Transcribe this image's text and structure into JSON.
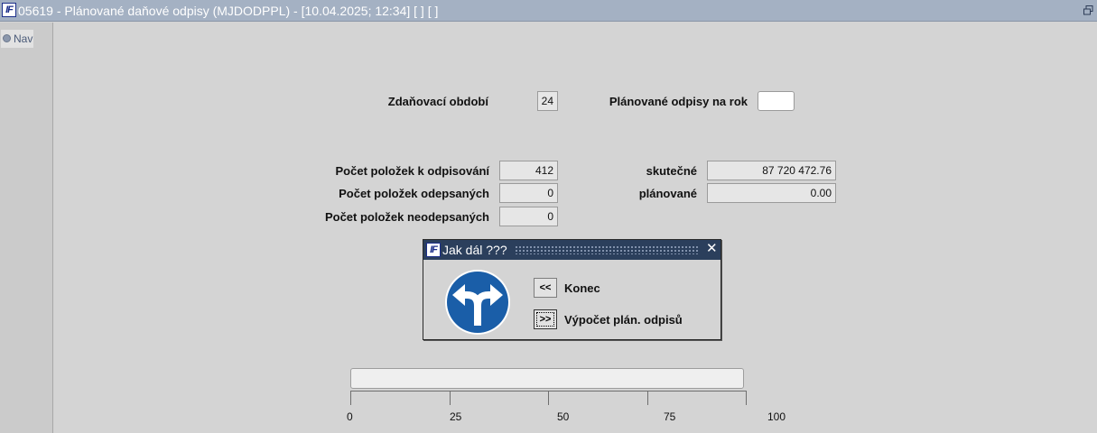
{
  "window": {
    "title": "05619 - Plánované daňové odpisy (MJDODPPL) - [10.04.2025; 12:34]  [ ]  [ ]",
    "logo_text": "IF"
  },
  "nav": {
    "label": "Nav"
  },
  "form": {
    "period_label": "Zdaňovací období",
    "period_value": "24",
    "planned_year_label": "Plánované odpisy na rok",
    "planned_year_value": "",
    "count_to_depreciate_label": "Počet položek k odpisování",
    "count_to_depreciate_value": "412",
    "count_depreciated_label": "Počet položek odepsaných",
    "count_depreciated_value": "0",
    "count_not_depreciated_label": "Počet položek neodepsaných",
    "count_not_depreciated_value": "0",
    "actual_label": "skutečné",
    "actual_value": "87 720 472.76",
    "planned_label": "plánované",
    "planned_value": "0.00"
  },
  "dialog": {
    "title": "Jak dál ???",
    "close_glyph": "✕",
    "back_button": "<<",
    "back_label": "Konec",
    "next_button": ">>",
    "next_label": "Výpočet plán. odpisů",
    "icon": "fork-arrow-icon"
  },
  "progress": {
    "value": 0,
    "ticks": [
      "0",
      "25",
      "50",
      "75",
      "100"
    ]
  },
  "colors": {
    "titlebar": "#a4b1c3",
    "dialog_titlebar": "#2b3f5c",
    "sign_blue": "#1a5ea8"
  }
}
